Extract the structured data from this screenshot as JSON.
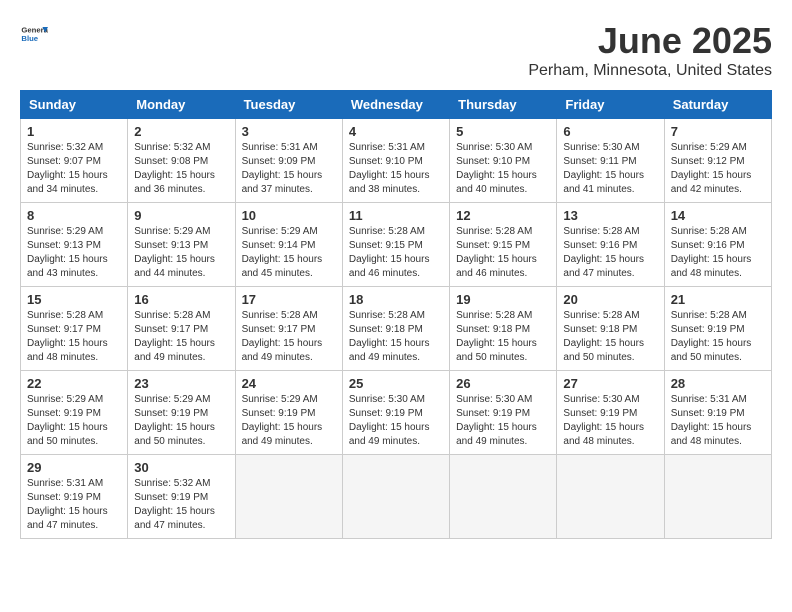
{
  "header": {
    "logo_general": "General",
    "logo_blue": "Blue",
    "title": "June 2025",
    "subtitle": "Perham, Minnesota, United States"
  },
  "calendar": {
    "columns": [
      "Sunday",
      "Monday",
      "Tuesday",
      "Wednesday",
      "Thursday",
      "Friday",
      "Saturday"
    ],
    "weeks": [
      [
        null,
        {
          "day": "2",
          "sunrise": "5:32 AM",
          "sunset": "9:08 PM",
          "daylight": "15 hours and 36 minutes."
        },
        {
          "day": "3",
          "sunrise": "5:31 AM",
          "sunset": "9:09 PM",
          "daylight": "15 hours and 37 minutes."
        },
        {
          "day": "4",
          "sunrise": "5:31 AM",
          "sunset": "9:10 PM",
          "daylight": "15 hours and 38 minutes."
        },
        {
          "day": "5",
          "sunrise": "5:30 AM",
          "sunset": "9:10 PM",
          "daylight": "15 hours and 40 minutes."
        },
        {
          "day": "6",
          "sunrise": "5:30 AM",
          "sunset": "9:11 PM",
          "daylight": "15 hours and 41 minutes."
        },
        {
          "day": "7",
          "sunrise": "5:29 AM",
          "sunset": "9:12 PM",
          "daylight": "15 hours and 42 minutes."
        }
      ],
      [
        {
          "day": "1",
          "sunrise": "5:32 AM",
          "sunset": "9:07 PM",
          "daylight": "15 hours and 34 minutes."
        },
        null,
        null,
        null,
        null,
        null,
        null
      ],
      [
        {
          "day": "8",
          "sunrise": "5:29 AM",
          "sunset": "9:13 PM",
          "daylight": "15 hours and 43 minutes."
        },
        {
          "day": "9",
          "sunrise": "5:29 AM",
          "sunset": "9:13 PM",
          "daylight": "15 hours and 44 minutes."
        },
        {
          "day": "10",
          "sunrise": "5:29 AM",
          "sunset": "9:14 PM",
          "daylight": "15 hours and 45 minutes."
        },
        {
          "day": "11",
          "sunrise": "5:28 AM",
          "sunset": "9:15 PM",
          "daylight": "15 hours and 46 minutes."
        },
        {
          "day": "12",
          "sunrise": "5:28 AM",
          "sunset": "9:15 PM",
          "daylight": "15 hours and 46 minutes."
        },
        {
          "day": "13",
          "sunrise": "5:28 AM",
          "sunset": "9:16 PM",
          "daylight": "15 hours and 47 minutes."
        },
        {
          "day": "14",
          "sunrise": "5:28 AM",
          "sunset": "9:16 PM",
          "daylight": "15 hours and 48 minutes."
        }
      ],
      [
        {
          "day": "15",
          "sunrise": "5:28 AM",
          "sunset": "9:17 PM",
          "daylight": "15 hours and 48 minutes."
        },
        {
          "day": "16",
          "sunrise": "5:28 AM",
          "sunset": "9:17 PM",
          "daylight": "15 hours and 49 minutes."
        },
        {
          "day": "17",
          "sunrise": "5:28 AM",
          "sunset": "9:17 PM",
          "daylight": "15 hours and 49 minutes."
        },
        {
          "day": "18",
          "sunrise": "5:28 AM",
          "sunset": "9:18 PM",
          "daylight": "15 hours and 49 minutes."
        },
        {
          "day": "19",
          "sunrise": "5:28 AM",
          "sunset": "9:18 PM",
          "daylight": "15 hours and 50 minutes."
        },
        {
          "day": "20",
          "sunrise": "5:28 AM",
          "sunset": "9:18 PM",
          "daylight": "15 hours and 50 minutes."
        },
        {
          "day": "21",
          "sunrise": "5:28 AM",
          "sunset": "9:19 PM",
          "daylight": "15 hours and 50 minutes."
        }
      ],
      [
        {
          "day": "22",
          "sunrise": "5:29 AM",
          "sunset": "9:19 PM",
          "daylight": "15 hours and 50 minutes."
        },
        {
          "day": "23",
          "sunrise": "5:29 AM",
          "sunset": "9:19 PM",
          "daylight": "15 hours and 50 minutes."
        },
        {
          "day": "24",
          "sunrise": "5:29 AM",
          "sunset": "9:19 PM",
          "daylight": "15 hours and 49 minutes."
        },
        {
          "day": "25",
          "sunrise": "5:30 AM",
          "sunset": "9:19 PM",
          "daylight": "15 hours and 49 minutes."
        },
        {
          "day": "26",
          "sunrise": "5:30 AM",
          "sunset": "9:19 PM",
          "daylight": "15 hours and 49 minutes."
        },
        {
          "day": "27",
          "sunrise": "5:30 AM",
          "sunset": "9:19 PM",
          "daylight": "15 hours and 48 minutes."
        },
        {
          "day": "28",
          "sunrise": "5:31 AM",
          "sunset": "9:19 PM",
          "daylight": "15 hours and 48 minutes."
        }
      ],
      [
        {
          "day": "29",
          "sunrise": "5:31 AM",
          "sunset": "9:19 PM",
          "daylight": "15 hours and 47 minutes."
        },
        {
          "day": "30",
          "sunrise": "5:32 AM",
          "sunset": "9:19 PM",
          "daylight": "15 hours and 47 minutes."
        },
        null,
        null,
        null,
        null,
        null
      ]
    ]
  }
}
